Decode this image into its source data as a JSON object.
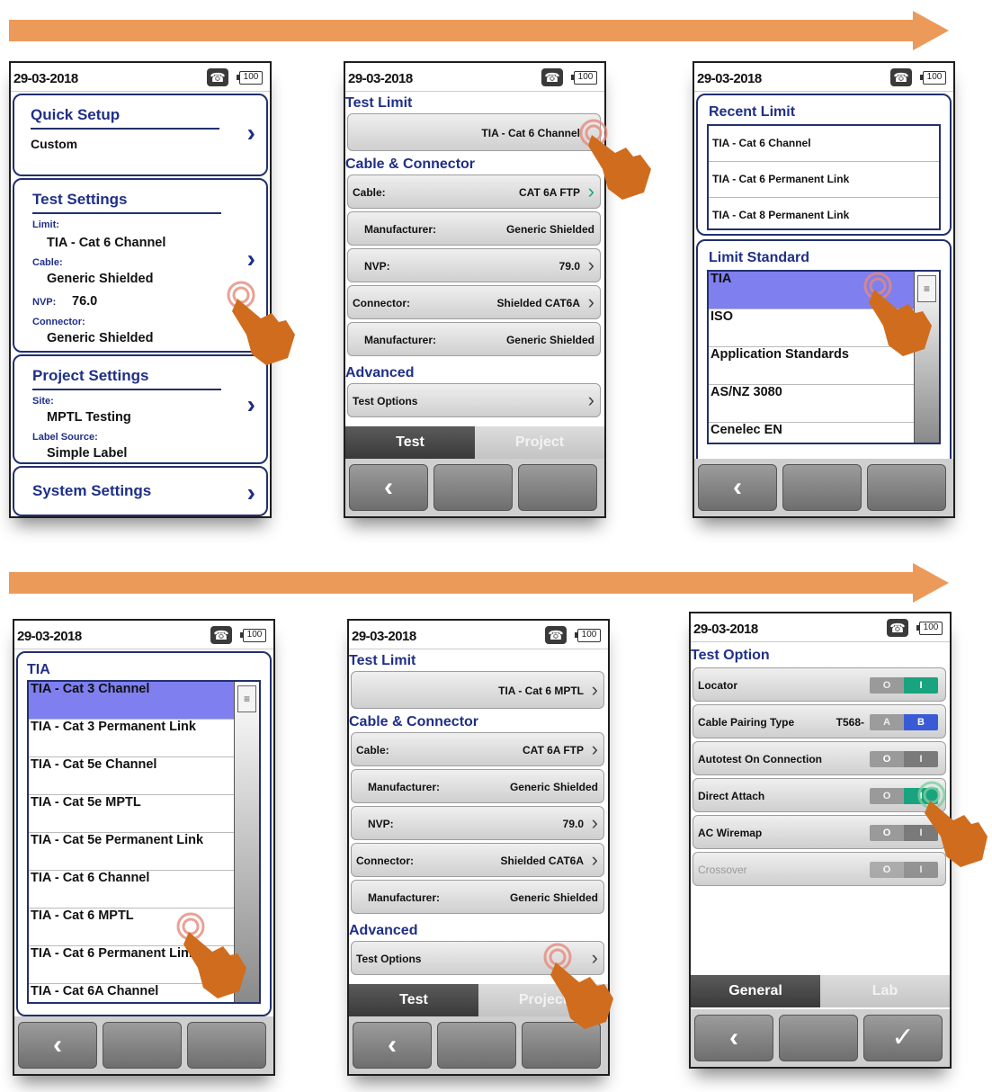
{
  "colors": {
    "arrow": "#ec9a5a",
    "accent": "#1f2f88",
    "selected": "#7f7ff0",
    "toggle_on": "#1aa37f",
    "toggle_blue": "#3b5bd6",
    "hand": "#d06c1e"
  },
  "icons": {
    "phone": "phone-icon",
    "battery": "battery-icon",
    "back": "back-arrow-icon",
    "check": "checkmark-icon",
    "chevron": "chevron-right-icon",
    "pointer": "pointing-hand-icon"
  },
  "screen1": {
    "date": "29-03-2018",
    "battery": "100",
    "quick_setup": {
      "title": "Quick Setup",
      "value": "Custom"
    },
    "test_settings": {
      "title": "Test Settings",
      "limit_label": "Limit:",
      "limit_value": "TIA - Cat 6 Channel",
      "cable_label": "Cable:",
      "cable_value": "Generic Shielded",
      "nvp_label": "NVP:",
      "nvp_value": "76.0",
      "connector_label": "Connector:",
      "connector_value": "Generic Shielded"
    },
    "project_settings": {
      "title": "Project Settings",
      "site_label": "Site:",
      "site_value": "MPTL Testing",
      "label_source_label": "Label Source:",
      "label_source_value": "Simple Label"
    },
    "system_settings": {
      "title": "System Settings"
    }
  },
  "screen2": {
    "date": "29-03-2018",
    "battery": "100",
    "test_limit_heading": "Test Limit",
    "test_limit_value": "TIA - Cat 6 Channel",
    "cable_heading": "Cable & Connector",
    "rows": [
      {
        "label": "Cable:",
        "value": "CAT 6A FTP"
      },
      {
        "label": "Manufacturer:",
        "value": "Generic Shielded"
      },
      {
        "label": "NVP:",
        "value": "79.0"
      },
      {
        "label": "Connector:",
        "value": "Shielded CAT6A"
      },
      {
        "label": "Manufacturer:",
        "value": "Generic Shielded"
      }
    ],
    "advanced_heading": "Advanced",
    "test_options": "Test Options",
    "tabs": [
      "Test",
      "Project"
    ]
  },
  "screen3": {
    "date": "29-03-2018",
    "battery": "100",
    "recent_heading": "Recent Limit",
    "recent": [
      "TIA - Cat 6 Channel",
      "TIA - Cat 6 Permanent Link",
      "TIA - Cat 8 Permanent Link"
    ],
    "standard_heading": "Limit Standard",
    "standards": [
      "TIA",
      "ISO",
      "Application Standards",
      "AS/NZ 3080",
      "Cenelec EN"
    ]
  },
  "screen4": {
    "date": "29-03-2018",
    "battery": "100",
    "heading": "TIA",
    "items": [
      "TIA - Cat 3 Channel",
      "TIA - Cat 3 Permanent Link",
      "TIA - Cat 5e Channel",
      "TIA - Cat 5e MPTL",
      "TIA - Cat 5e Permanent Link",
      "TIA - Cat 6 Channel",
      "TIA - Cat 6 MPTL",
      "TIA - Cat 6 Permanent Link",
      "TIA - Cat 6A Channel"
    ]
  },
  "screen5": {
    "date": "29-03-2018",
    "battery": "100",
    "test_limit_heading": "Test Limit",
    "test_limit_value": "TIA - Cat 6 MPTL",
    "cable_heading": "Cable & Connector",
    "rows": [
      {
        "label": "Cable:",
        "value": "CAT 6A FTP"
      },
      {
        "label": "Manufacturer:",
        "value": "Generic Shielded"
      },
      {
        "label": "NVP:",
        "value": "79.0"
      },
      {
        "label": "Connector:",
        "value": "Shielded CAT6A"
      },
      {
        "label": "Manufacturer:",
        "value": "Generic Shielded"
      }
    ],
    "advanced_heading": "Advanced",
    "test_options": "Test Options",
    "tabs": [
      "Test",
      "Project"
    ]
  },
  "screen6": {
    "date": "29-03-2018",
    "battery": "100",
    "heading": "Test Option",
    "options": [
      {
        "label": "Locator",
        "off": "O",
        "on": "I",
        "state": "on"
      },
      {
        "label": "Cable Pairing Type",
        "prefix": "T568-",
        "off": "A",
        "on": "B",
        "state": "B"
      },
      {
        "label": "Autotest On Connection",
        "off": "O",
        "on": "I",
        "state": "off"
      },
      {
        "label": "Direct Attach",
        "off": "O",
        "on": "I",
        "state": "on"
      },
      {
        "label": "AC Wiremap",
        "off": "O",
        "on": "I",
        "state": "off"
      },
      {
        "label": "Crossover",
        "off": "O",
        "on": "I",
        "state": "disabled"
      }
    ],
    "tabs": [
      "General",
      "Lab"
    ],
    "back": "‹",
    "confirm": "✓"
  }
}
